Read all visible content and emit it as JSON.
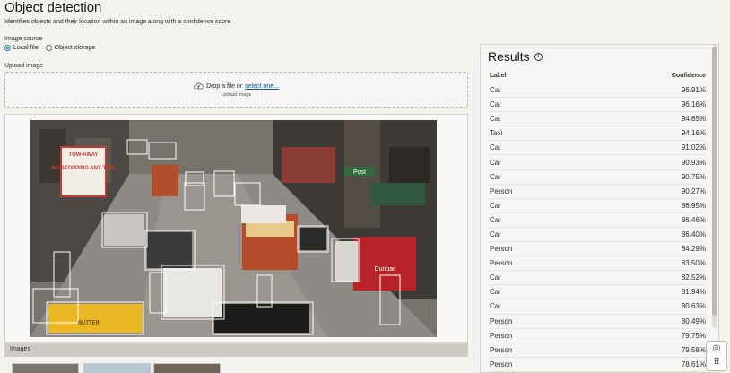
{
  "page": {
    "title": "Object detection",
    "subtitle": "Identifies objects and their location within an image along with a confidence score"
  },
  "image_source": {
    "label": "Image source",
    "options": [
      "Local file",
      "Object storage"
    ],
    "selected": "Local file"
  },
  "upload": {
    "label": "Upload image",
    "drop_text": "Drop a file or",
    "drop_link": "select one...",
    "hint": "Upload image",
    "icon": "cloud-upload-icon"
  },
  "gallery": {
    "label": "Images"
  },
  "scene_text": {
    "sign_top": "TOW-AWAY",
    "sign_mid": "NO STOPPING ANY TIME",
    "street": "Post",
    "cable_car": "Dunbar",
    "taxi": "BUTTER"
  },
  "results": {
    "title": "Results",
    "col_label": "Label",
    "col_confidence": "Confidence",
    "rows": [
      {
        "label": "Car",
        "confidence": "96.91%"
      },
      {
        "label": "Car",
        "confidence": "96.16%"
      },
      {
        "label": "Car",
        "confidence": "94.65%"
      },
      {
        "label": "Taxi",
        "confidence": "94.16%"
      },
      {
        "label": "Car",
        "confidence": "91.02%"
      },
      {
        "label": "Car",
        "confidence": "90.93%"
      },
      {
        "label": "Car",
        "confidence": "90.75%"
      },
      {
        "label": "Person",
        "confidence": "90.27%"
      },
      {
        "label": "Car",
        "confidence": "86.95%"
      },
      {
        "label": "Car",
        "confidence": "86.46%"
      },
      {
        "label": "Car",
        "confidence": "86.40%"
      },
      {
        "label": "Person",
        "confidence": "84.29%"
      },
      {
        "label": "Person",
        "confidence": "83.50%"
      },
      {
        "label": "Car",
        "confidence": "82.52%"
      },
      {
        "label": "Car",
        "confidence": "81.94%"
      },
      {
        "label": "Car",
        "confidence": "80.63%"
      },
      {
        "label": "Person",
        "confidence": "80.49%"
      },
      {
        "label": "Person",
        "confidence": "79.75%"
      },
      {
        "label": "Person",
        "confidence": "79.58%"
      },
      {
        "label": "Person",
        "confidence": "78.61%"
      }
    ]
  },
  "colors": {
    "accent": "#227e9e",
    "link": "#0b5fa5",
    "box": "#ffffff"
  }
}
